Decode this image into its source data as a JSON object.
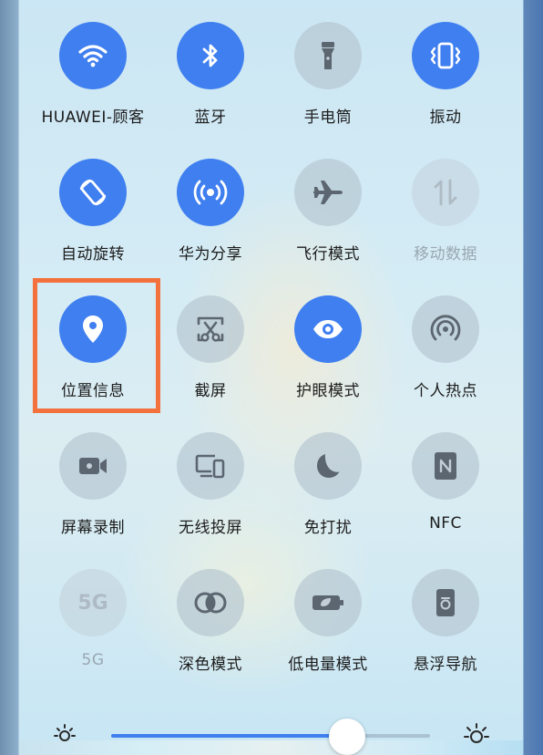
{
  "colors": {
    "active": "#3f7ff0",
    "highlight": "#f2713d"
  },
  "tiles": [
    {
      "label": "HUAWEI-顾客",
      "icon": "wifi-icon",
      "state": "on"
    },
    {
      "label": "蓝牙",
      "icon": "bluetooth-icon",
      "state": "on"
    },
    {
      "label": "手电筒",
      "icon": "flashlight-icon",
      "state": "off"
    },
    {
      "label": "振动",
      "icon": "vibrate-icon",
      "state": "on"
    },
    {
      "label": "自动旋转",
      "icon": "auto-rotate-icon",
      "state": "on"
    },
    {
      "label": "华为分享",
      "icon": "huawei-share-icon",
      "state": "on"
    },
    {
      "label": "飞行模式",
      "icon": "airplane-icon",
      "state": "off"
    },
    {
      "label": "移动数据",
      "icon": "mobile-data-icon",
      "state": "disabled"
    },
    {
      "label": "位置信息",
      "icon": "location-pin-icon",
      "state": "on"
    },
    {
      "label": "截屏",
      "icon": "screenshot-scissors-icon",
      "state": "off"
    },
    {
      "label": "护眼模式",
      "icon": "eye-icon",
      "state": "on"
    },
    {
      "label": "个人热点",
      "icon": "hotspot-icon",
      "state": "off"
    },
    {
      "label": "屏幕录制",
      "icon": "video-camera-icon",
      "state": "off"
    },
    {
      "label": "无线投屏",
      "icon": "screen-cast-icon",
      "state": "off"
    },
    {
      "label": "免打扰",
      "icon": "moon-icon",
      "state": "off"
    },
    {
      "label": "NFC",
      "icon": "nfc-icon",
      "state": "off"
    },
    {
      "label": "5G",
      "icon": "5g-icon",
      "state": "disabled",
      "icon_text": "5G"
    },
    {
      "label": "深色模式",
      "icon": "dark-mode-icon",
      "state": "off"
    },
    {
      "label": "低电量模式",
      "icon": "battery-saver-icon",
      "state": "off"
    },
    {
      "label": "悬浮导航",
      "icon": "floating-nav-icon",
      "state": "off"
    }
  ],
  "brightness": {
    "level": 0.74,
    "low_icon": "sun-dim-icon",
    "high_icon": "sun-bright-icon"
  }
}
